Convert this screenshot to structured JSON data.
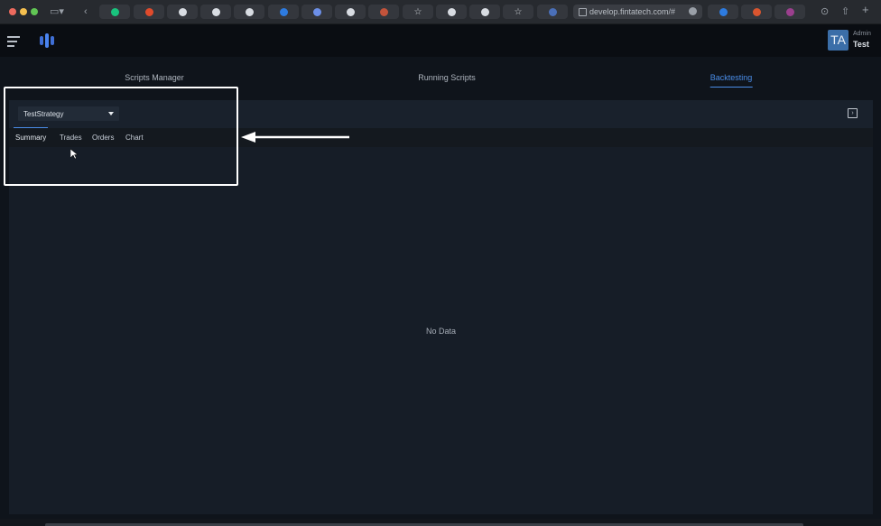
{
  "browser": {
    "url": "develop.fintatech.com/#",
    "tabs": [
      {
        "icon": "chatgpt-icon",
        "color": "#19c37d"
      },
      {
        "icon": "app-icon",
        "color": "#e04b2c"
      },
      {
        "icon": "shield-icon",
        "color": "#d8dce2"
      },
      {
        "icon": "shield-icon",
        "color": "#d8dce2"
      },
      {
        "icon": "google-icon",
        "color": "#d8dce2"
      },
      {
        "icon": "app-icon",
        "color": "#2d7be0"
      },
      {
        "icon": "app-icon",
        "color": "#6c8fe8"
      },
      {
        "icon": "shield-icon",
        "color": "#d8dce2"
      },
      {
        "icon": "app-icon",
        "color": "#c2533b"
      },
      {
        "icon": "star-icon",
        "color": "#cfd3d8"
      },
      {
        "icon": "apple-icon",
        "color": "#d8dce2"
      },
      {
        "icon": "apple-icon",
        "color": "#d8dce2"
      },
      {
        "icon": "star-icon",
        "color": "#cfd3d8"
      },
      {
        "icon": "app-icon",
        "color": "#4a6fb8"
      },
      {
        "icon": "app-icon",
        "color": "#2d7be0"
      },
      {
        "icon": "app-icon",
        "color": "#d9552f"
      },
      {
        "icon": "app-icon",
        "color": "#9b3f8e"
      }
    ]
  },
  "header": {
    "avatar_initials": "TA",
    "user_role": "Admin",
    "user_name": "Test",
    "accent": "#4a8de8"
  },
  "main_tabs": [
    {
      "label": "Scripts Manager",
      "active": false
    },
    {
      "label": "Running Scripts",
      "active": false
    },
    {
      "label": "Backtesting",
      "active": true
    }
  ],
  "panel": {
    "strategy_select": "TestStrategy",
    "sub_tabs": [
      {
        "label": "Summary",
        "active": true
      },
      {
        "label": "Trades",
        "active": false
      },
      {
        "label": "Orders",
        "active": false
      },
      {
        "label": "Chart",
        "active": false
      }
    ],
    "empty_text": "No Data"
  }
}
